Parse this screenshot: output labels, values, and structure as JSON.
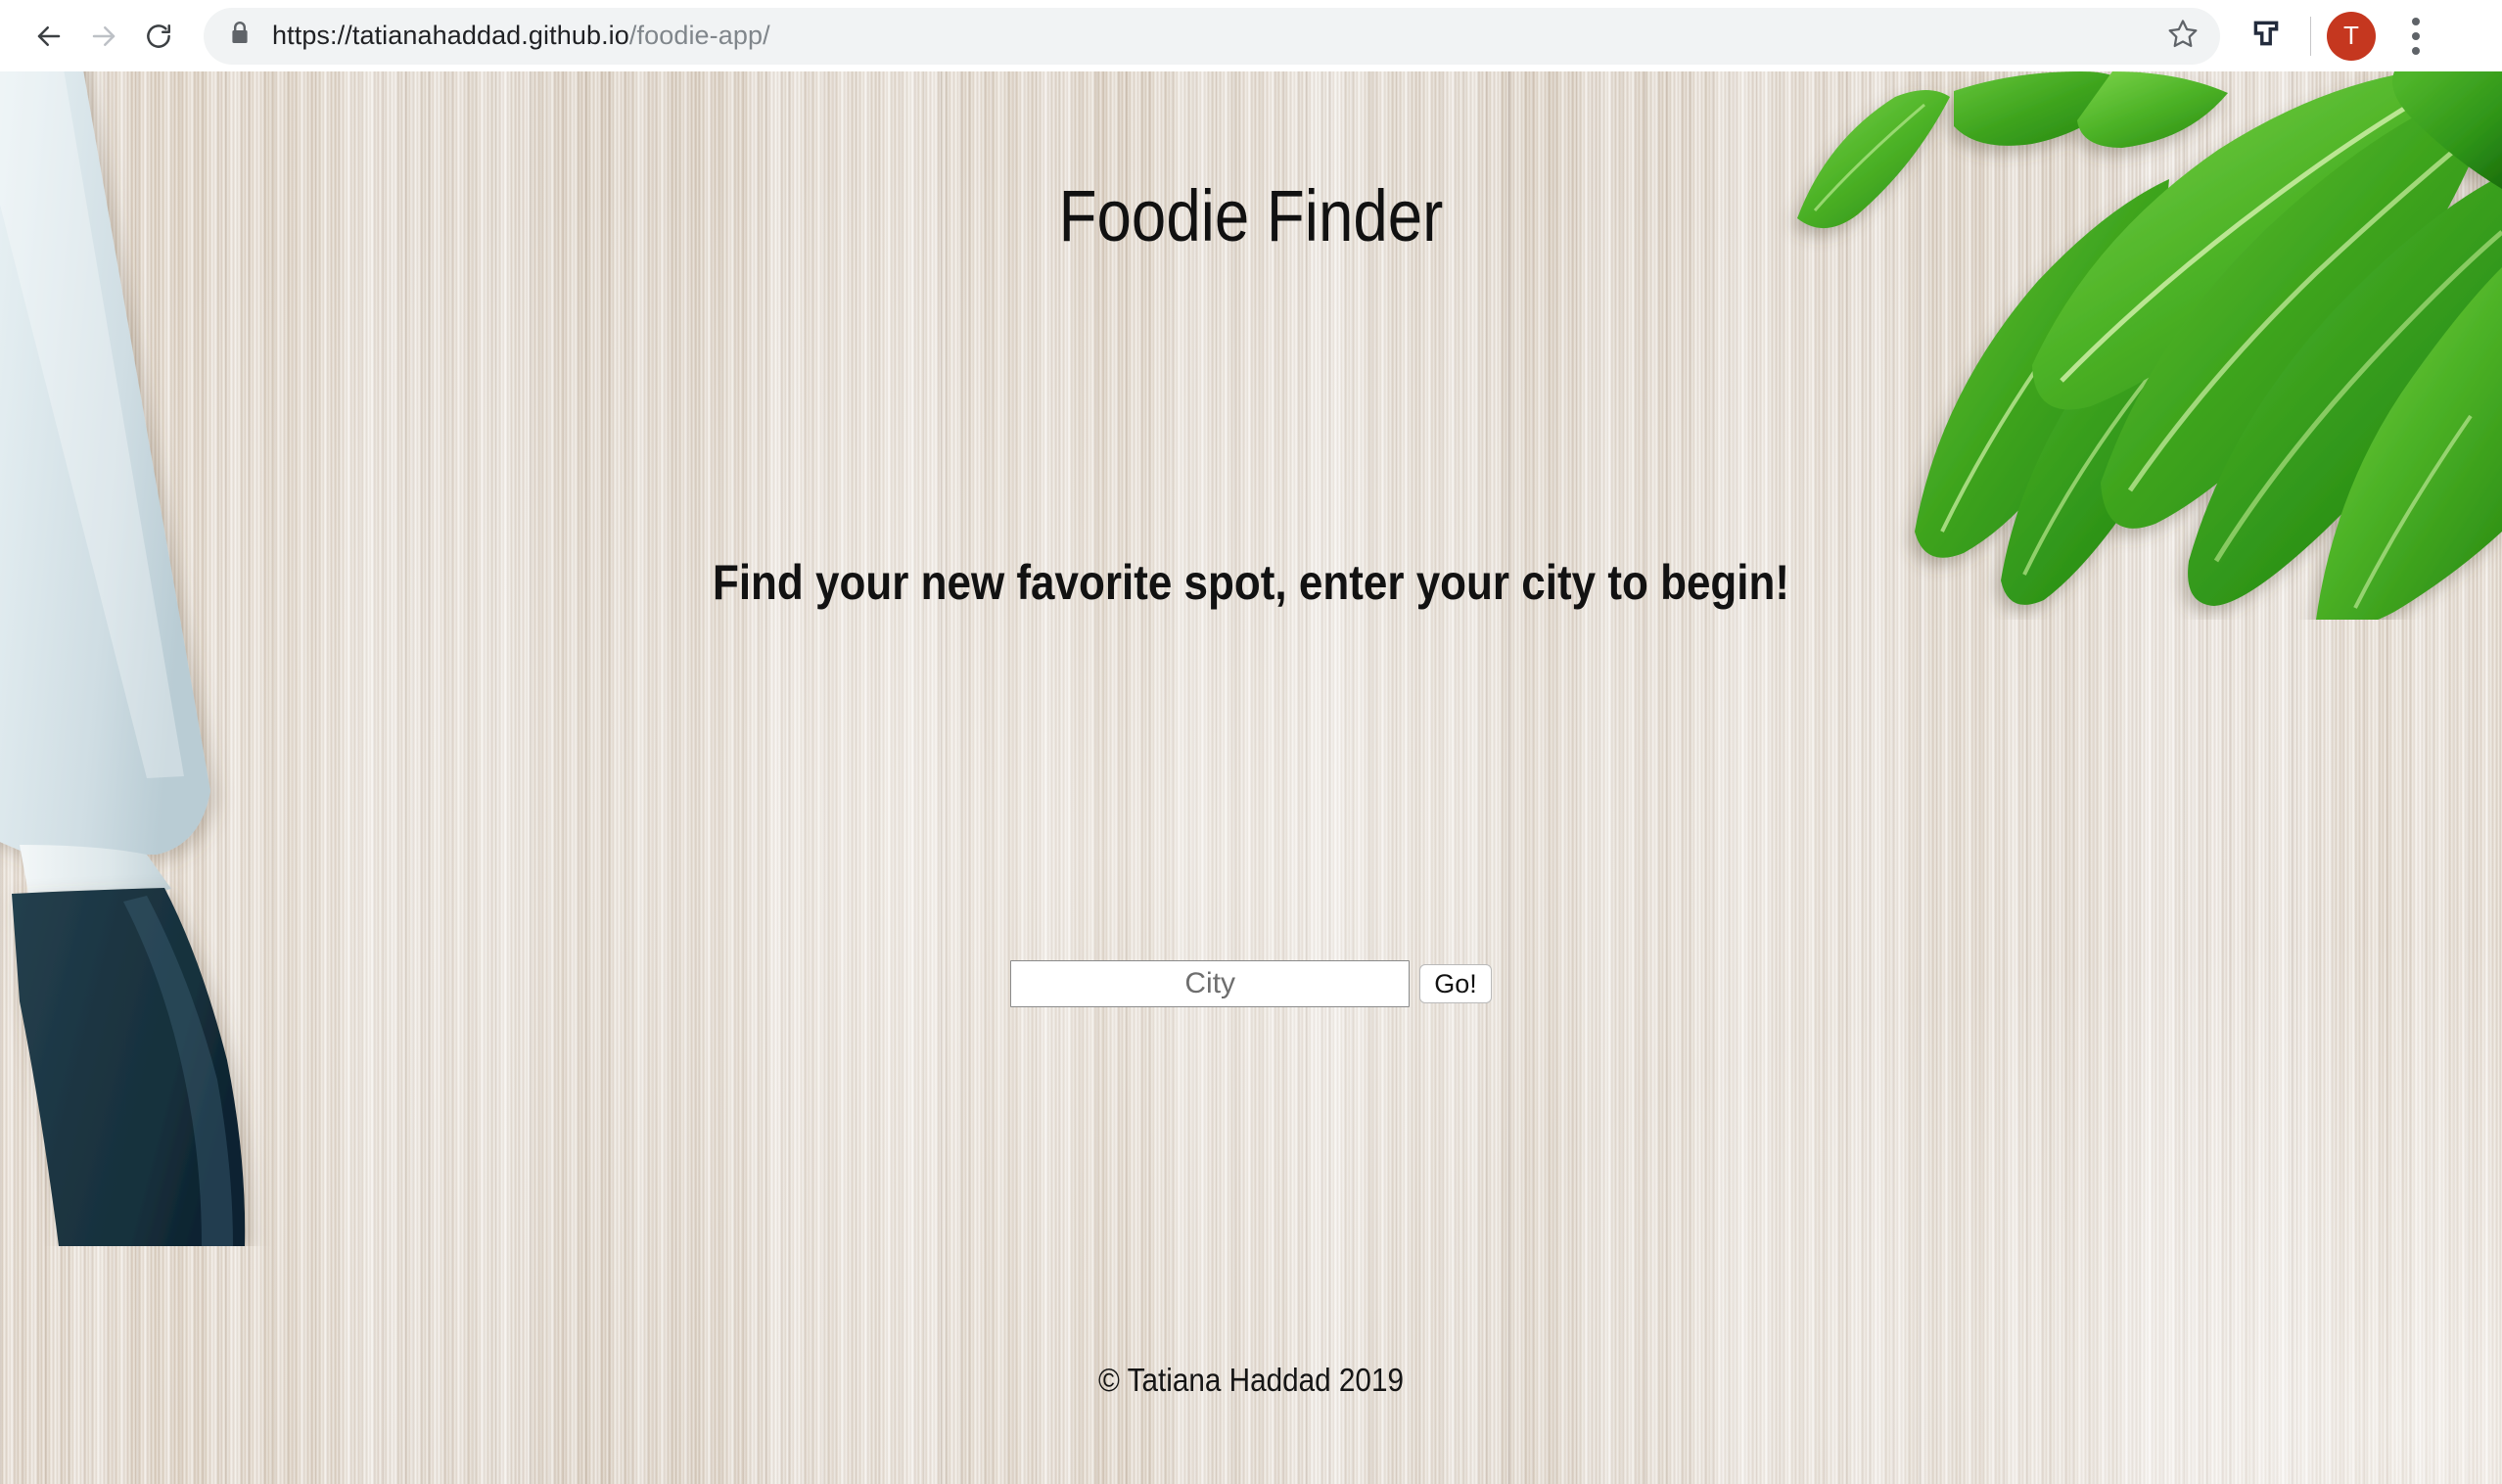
{
  "browser": {
    "back_icon": "back-arrow-icon",
    "forward_icon": "forward-arrow-icon",
    "reload_icon": "reload-icon",
    "lock_icon": "lock-icon",
    "url_secure": "https://tatianahaddad.github.io",
    "url_path": "/foodie-app/",
    "url_full": "https://tatianahaddad.github.io/foodie-app/",
    "star_icon": "bookmark-star-icon",
    "extension_icon": "extension-t-icon",
    "avatar_initial": "T",
    "avatar_color": "#c5371f",
    "menu_icon": "three-dot-menu-icon"
  },
  "page": {
    "title": "Foodie Finder",
    "tagline": "Find your new favorite spot, enter your city to begin!",
    "search": {
      "placeholder": "City",
      "value": "",
      "button_label": "Go!"
    },
    "footer": "© Tatiana Haddad 2019",
    "background": {
      "description": "wood-board-with-knife-and-green-leaves-photo",
      "wood_color": "#ded4c7",
      "knife_blade_color": "#dfe9ec",
      "knife_handle_color": "#1e3a47",
      "leaf_color": "#3faa21"
    }
  }
}
